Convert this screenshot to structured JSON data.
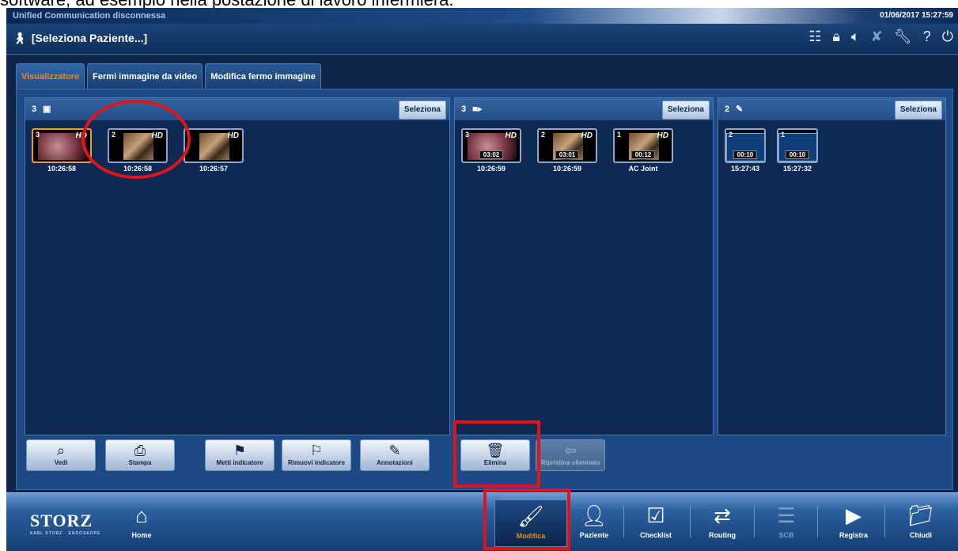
{
  "caption": "software, ad esempio nella postazione di lavoro infermiera.",
  "window": {
    "title": "Unified Communication disconnessa",
    "datetime": "01/06/2017  15:27:59"
  },
  "patient": {
    "label": "[Seleziona Paziente...]"
  },
  "sys_icons": [
    "sliders-icon",
    "lock-icon",
    "speaker-icon",
    "mic-off-icon",
    "wrench-icon",
    "help-icon",
    "power-icon"
  ],
  "tabs": [
    {
      "label": "Visualizzatore",
      "active": true
    },
    {
      "label": "Fermi immagine da video",
      "active": false
    },
    {
      "label": "Modifica fermo immagine",
      "active": false
    }
  ],
  "panels": [
    {
      "count": "3",
      "icon": "camera-icon",
      "select_label": "Seleziona",
      "items": [
        {
          "num": "3",
          "hd": "HD",
          "time": "10:26:58",
          "kind": "endo",
          "selected": true
        },
        {
          "num": "2",
          "hd": "HD",
          "time": "10:26:58",
          "kind": "room",
          "selected": false
        },
        {
          "num": "",
          "hd": "HD",
          "time": "10:26:57",
          "kind": "room",
          "selected": false
        }
      ]
    },
    {
      "count": "3",
      "icon": "video-icon",
      "select_label": "Seleziona",
      "items": [
        {
          "num": "3",
          "hd": "HD",
          "duration": "03:02",
          "time": "10:26:59",
          "kind": "endo"
        },
        {
          "num": "2",
          "hd": "HD",
          "duration": "03:01",
          "time": "10:26:59",
          "kind": "room"
        },
        {
          "num": "1",
          "hd": "HD",
          "duration": "00:12",
          "time": "AC Joint",
          "kind": "room"
        }
      ]
    },
    {
      "count": "2",
      "icon": "pen-icon",
      "select_label": "Seleziona",
      "items": [
        {
          "num": "2",
          "duration": "00:10",
          "time": "15:27:43",
          "kind": "curve"
        },
        {
          "num": "1",
          "duration": "00:10",
          "time": "15:27:32",
          "kind": "curve"
        }
      ]
    }
  ],
  "actions": [
    {
      "label": "Vedi",
      "icon": "magnifier-icon",
      "enabled": true
    },
    {
      "label": "Stampa",
      "icon": "printer-icon",
      "enabled": true
    },
    {
      "label": "Metti indicatore",
      "icon": "flag-icon",
      "enabled": true
    },
    {
      "label": "Rimuovi indicatore",
      "icon": "flag-remove-icon",
      "enabled": true
    },
    {
      "label": "Annotazioni",
      "icon": "pencil-icon",
      "enabled": true
    },
    {
      "label": "Elimina",
      "icon": "trash-icon",
      "enabled": true
    },
    {
      "label": "Ripristina eliminato",
      "icon": "restore-icon",
      "enabled": false
    }
  ],
  "footer": {
    "logo": {
      "name": "STORZ",
      "sub": "KARL STORZ · ENDOSKOPE"
    },
    "home": "Home",
    "nav": [
      {
        "label": "Modifica",
        "icon": "edit-image-icon",
        "active": true
      },
      {
        "label": "Paziente",
        "icon": "patient-icon"
      },
      {
        "label": "Checklist",
        "icon": "checklist-icon"
      },
      {
        "label": "Routing",
        "icon": "routing-icon"
      },
      {
        "label": "SCB",
        "icon": "scb-icon",
        "disabled": true
      },
      {
        "label": "Registra",
        "icon": "record-icon"
      },
      {
        "label": "Chiudi",
        "icon": "folder-close-icon"
      }
    ]
  },
  "colors": {
    "highlight": "#e0141a",
    "active_tab": "#f08a1a",
    "background": "#0c2448"
  }
}
